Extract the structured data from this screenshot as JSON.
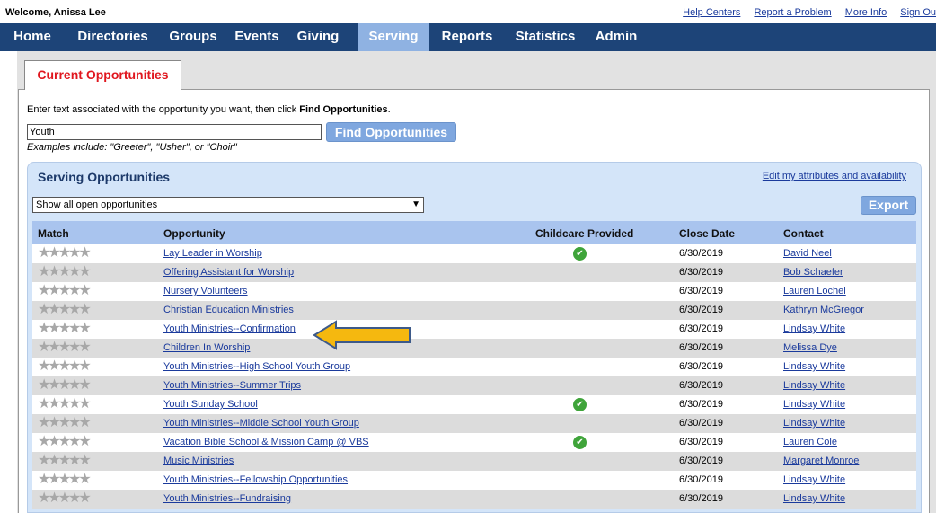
{
  "header": {
    "welcome": "Welcome, Anissa Lee",
    "links": [
      "Help Centers",
      "Report a Problem",
      "More Info",
      "Sign Ou"
    ]
  },
  "nav": {
    "items": [
      "Home",
      "Directories",
      "Groups",
      "Events",
      "Giving",
      "Serving",
      "Reports",
      "Statistics",
      "Admin"
    ],
    "active": "Serving"
  },
  "tab": {
    "label": "Current Opportunities"
  },
  "search": {
    "instruction_prefix": "Enter text associated with the opportunity you want, then click ",
    "instruction_bold": "Find Opportunities",
    "instruction_suffix": ".",
    "value": "Youth",
    "button": "Find Opportunities",
    "examples": "Examples include: \"Greeter\", \"Usher\", or \"Choir\""
  },
  "opportunities": {
    "title": "Serving Opportunities",
    "edit_link": "Edit my attributes and availability",
    "filter": "Show all open opportunities",
    "export": "Export",
    "columns": [
      "Match",
      "Opportunity",
      "Childcare Provided",
      "Close Date",
      "Contact"
    ],
    "rows": [
      {
        "opportunity": "Lay Leader in Worship",
        "childcare": true,
        "close": "6/30/2019",
        "contact": "David Neel"
      },
      {
        "opportunity": "Offering Assistant for Worship",
        "childcare": false,
        "close": "6/30/2019",
        "contact": "Bob Schaefer"
      },
      {
        "opportunity": "Nursery Volunteers",
        "childcare": false,
        "close": "6/30/2019",
        "contact": "Lauren Lochel"
      },
      {
        "opportunity": "Christian Education Ministries",
        "childcare": false,
        "close": "6/30/2019",
        "contact": "Kathryn McGregor"
      },
      {
        "opportunity": "Youth Ministries--Confirmation",
        "childcare": false,
        "close": "6/30/2019",
        "contact": "Lindsay White"
      },
      {
        "opportunity": "Children In Worship",
        "childcare": false,
        "close": "6/30/2019",
        "contact": "Melissa Dye"
      },
      {
        "opportunity": "Youth Ministries--High School Youth Group",
        "childcare": false,
        "close": "6/30/2019",
        "contact": "Lindsay White"
      },
      {
        "opportunity": "Youth Ministries--Summer Trips",
        "childcare": false,
        "close": "6/30/2019",
        "contact": "Lindsay White"
      },
      {
        "opportunity": "Youth Sunday School",
        "childcare": true,
        "close": "6/30/2019",
        "contact": "Lindsay White"
      },
      {
        "opportunity": "Youth Ministries--Middle School Youth Group",
        "childcare": false,
        "close": "6/30/2019",
        "contact": "Lindsay White"
      },
      {
        "opportunity": "Vacation Bible School & Mission Camp @ VBS",
        "childcare": true,
        "close": "6/30/2019",
        "contact": "Lauren Cole"
      },
      {
        "opportunity": "Music Ministries",
        "childcare": false,
        "close": "6/30/2019",
        "contact": "Margaret Monroe"
      },
      {
        "opportunity": "Youth Ministries--Fellowship Opportunities",
        "childcare": false,
        "close": "6/30/2019",
        "contact": "Lindsay White"
      },
      {
        "opportunity": "Youth Ministries--Fundraising",
        "childcare": false,
        "close": "6/30/2019",
        "contact": "Lindsay White"
      }
    ]
  },
  "colors": {
    "nav_bg": "#1d4478",
    "nav_active": "#8fb2e2",
    "tab_text": "#e0161e",
    "header_row": "#a9c4ee",
    "panel_bg": "#d4e5f9",
    "arrow_fill": "#f5b80f"
  },
  "icons": {
    "match": "star-rating-icon",
    "childcare": "check-circle-icon",
    "annotation": "arrow-left-icon"
  }
}
